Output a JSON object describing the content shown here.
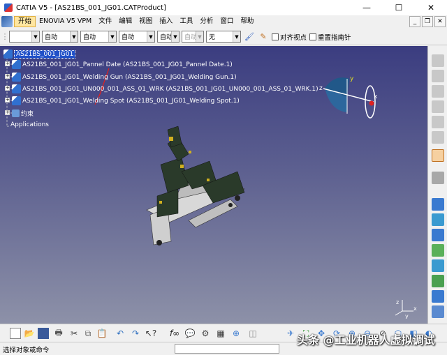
{
  "window": {
    "title": "CATIA V5 - [AS21BS_001_JG01.CATProduct]",
    "controls": [
      "—",
      "☐",
      "✕"
    ]
  },
  "menubar": {
    "items": [
      "开始",
      "ENOVIA V5 VPM",
      "文件",
      "编辑",
      "视图",
      "插入",
      "工具",
      "分析",
      "窗口",
      "帮助"
    ]
  },
  "style_toolbar": {
    "combo1": "",
    "combo2": "自动",
    "combo3": "自动",
    "combo4": "自动",
    "combo5": "自动",
    "combo6": "自动",
    "combo7": "无",
    "check1_label": "对齐视点",
    "check2_label": "重置指南针"
  },
  "tree": {
    "root": "AS21BS_001_JG01",
    "children": [
      "AS21BS_001_JG01_Pannel Date (AS21BS_001_JG01_Pannel Date.1)",
      "AS21BS_001_JG01_Welding Gun (AS21BS_001_JG01_Welding Gun.1)",
      "AS21BS_001_JG01_UN000_001_ASS_01_WRK (AS21BS_001_JG01_UN000_001_ASS_01_WRK.1)",
      "AS21BS_001_JG01_Welding Spot (AS21BS_001_JG01_Welding Spot.1)",
      "约束",
      "Applications"
    ]
  },
  "compass": {
    "x_label": "z",
    "y_label": "y",
    "axes_label": "x"
  },
  "axis_triad": {
    "x": "x",
    "y": "y",
    "z": "z"
  },
  "statusbar": {
    "text": "选择对象或命令"
  },
  "watermark": "头条 @工业机器人虚拟调试"
}
